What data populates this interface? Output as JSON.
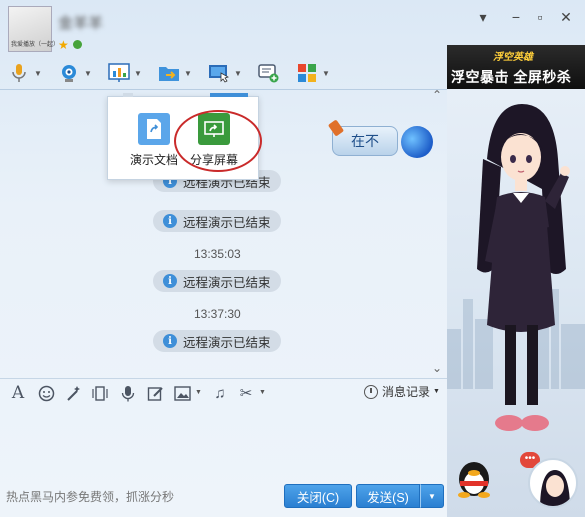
{
  "window": {
    "username": "金羊羊",
    "avatar_caption": "我爱播放（一起）",
    "controls": [
      "minimize",
      "restore",
      "close"
    ]
  },
  "toolbar": {
    "items": [
      {
        "name": "voice",
        "icon": "microphone-icon"
      },
      {
        "name": "video",
        "icon": "camera-icon"
      },
      {
        "name": "remote-demo",
        "icon": "presentation-icon"
      },
      {
        "name": "file-transfer",
        "icon": "folder-icon"
      },
      {
        "name": "remote-desktop",
        "icon": "monitor-icon"
      },
      {
        "name": "invite",
        "icon": "chat-add-icon"
      },
      {
        "name": "apps",
        "icon": "apps-grid-icon"
      }
    ]
  },
  "ad": {
    "brand": "浮空英雄",
    "slogan": "浮空暴击 全屏秒杀"
  },
  "popup": {
    "items": [
      {
        "label": "演示文档"
      },
      {
        "label": "分享屏幕"
      }
    ]
  },
  "status_bubble": "在不",
  "messages": [
    {
      "type": "notice",
      "text": "远程演示已结束"
    },
    {
      "type": "notice",
      "text": "远程演示已结束"
    },
    {
      "type": "time",
      "text": "13:35:03"
    },
    {
      "type": "notice",
      "text": "远程演示已结束"
    },
    {
      "type": "time",
      "text": "13:37:30"
    },
    {
      "type": "notice",
      "text": "远程演示已结束"
    }
  ],
  "compose": {
    "tools": [
      "font-icon",
      "emoji-icon",
      "magic-icon",
      "vibrate-icon",
      "voice-message-icon",
      "doodle-icon",
      "image-icon",
      "music-icon",
      "screenshot-icon"
    ],
    "history_label": "消息记录"
  },
  "bottom": {
    "hot_text": "热点黑马内参免费领，抓涨分秒",
    "close_label": "关闭(C)",
    "send_label": "发送(S)"
  },
  "colors": {
    "accent": "#2a7fd1",
    "highlight_ring": "#c92a2a",
    "notice_bg": "#d3dce6"
  }
}
